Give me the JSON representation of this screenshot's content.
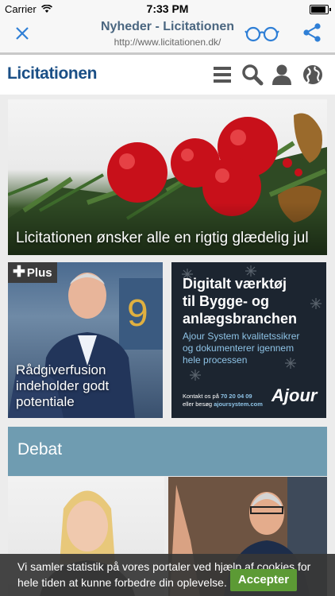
{
  "status_bar": {
    "carrier": "Carrier",
    "time": "7:33 PM",
    "battery_level": 0.9
  },
  "nav": {
    "title": "Nyheder - Licitationen",
    "url": "http://www.licitationen.dk/"
  },
  "site": {
    "logo": "Licitationen"
  },
  "hero": {
    "caption": "Licitationen ønsker alle en rigtig glædelig jul"
  },
  "article_card": {
    "badge": "Plus",
    "caption": "Rådgiverfusion indeholder godt potentiale"
  },
  "ad": {
    "headline_1": "Digitalt værktøj",
    "headline_2": "til Bygge- og",
    "headline_3": "anlægsbranchen",
    "sub_1": "Ajour System kvalitetssikrer",
    "sub_2": "og dokumenterer igennem",
    "sub_3": "hele processen",
    "contact_1a": "Kontakt os på",
    "contact_1b": "70 20 04 09",
    "contact_2a": "eller besøg",
    "contact_2b": "ajoursystem.com",
    "brand": "Ajour"
  },
  "section": {
    "title": "Debat"
  },
  "cookie": {
    "text": "Vi samler statistik på vores portaler ved hjælp af cookies for hele tiden at kunne forbedre din oplevelse.",
    "accept": "Accepter"
  },
  "colors": {
    "brand_blue": "#1a4f86",
    "nav_icon": "#2f7fd6",
    "debat_bar": "#6f9cb1",
    "accept_green": "#5c9a35"
  }
}
